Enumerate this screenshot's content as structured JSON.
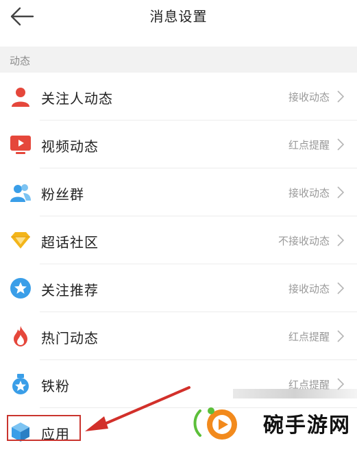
{
  "header": {
    "title": "消息设置",
    "back_icon": "arrow-left-icon"
  },
  "section": {
    "title": "动态"
  },
  "rows": [
    {
      "label": "关注人动态",
      "value": "接收动态",
      "icon": "person-icon",
      "color": "#e5473b"
    },
    {
      "label": "视频动态",
      "value": "红点提醒",
      "icon": "video-play-icon",
      "color": "#e5473b"
    },
    {
      "label": "粉丝群",
      "value": "接收动态",
      "icon": "group-icon",
      "color": "#3a9ee8"
    },
    {
      "label": "超话社区",
      "value": "不接收动态",
      "icon": "diamond-icon",
      "color": "#f3b51a"
    },
    {
      "label": "关注推荐",
      "value": "接收动态",
      "icon": "star-badge-icon",
      "color": "#3a9ee8"
    },
    {
      "label": "热门动态",
      "value": "红点提醒",
      "icon": "flame-icon",
      "color": "#e5473b"
    },
    {
      "label": "铁粉",
      "value": "红点提醒",
      "icon": "medal-icon",
      "color": "#3a9ee8"
    },
    {
      "label": "应用",
      "value": "",
      "icon": "cube-icon",
      "color": "#3a9ee8"
    }
  ],
  "annotation": {
    "highlight_color": "#c9342e"
  },
  "watermark": {
    "text": "碗手游网"
  }
}
